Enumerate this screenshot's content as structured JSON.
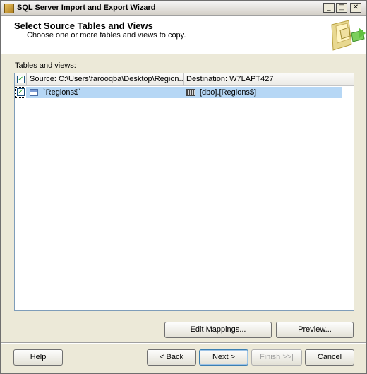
{
  "window": {
    "title": "SQL Server Import and Export Wizard",
    "controls": {
      "minimize": "_",
      "maximize": "□",
      "close": "✕"
    }
  },
  "header": {
    "title": "Select Source Tables and Views",
    "subtitle": "Choose one or more tables and views to copy."
  },
  "tables_label": "Tables and views:",
  "grid": {
    "columns": [
      {
        "label": "Source: C:\\Users\\farooqba\\Desktop\\Region...."
      },
      {
        "label": "Destination: W7LAPT427"
      }
    ],
    "header_checked": "✓",
    "rows": [
      {
        "checked": "✓",
        "source": "`Regions$`",
        "destination": "[dbo].[Regions$]"
      }
    ]
  },
  "buttons": {
    "edit_mappings": "Edit Mappings...",
    "preview": "Preview...",
    "help": "Help",
    "back": "< Back",
    "next": "Next >",
    "finish": "Finish >>|",
    "cancel": "Cancel"
  },
  "colors": {
    "selection": "#b6d7f5",
    "checkmark": "#21a121",
    "window_bg": "#ece9d8"
  }
}
